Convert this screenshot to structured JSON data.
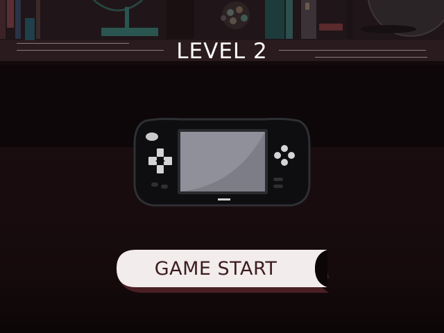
{
  "level": {
    "title": "LEVEL 2"
  },
  "console": {
    "icon": "handheld-game-console-icon",
    "screen_color": "#8f9099",
    "body_color": "#0e0e10",
    "outline_color": "#2e3033"
  },
  "start_button": {
    "label": "GAME START",
    "bg_color": "#f2ecec",
    "text_color": "#3b1c1f",
    "shadow_color": "#4a1f24"
  },
  "background": {
    "shelf_color": "#201518",
    "floor_color": "#1a0d0f"
  }
}
